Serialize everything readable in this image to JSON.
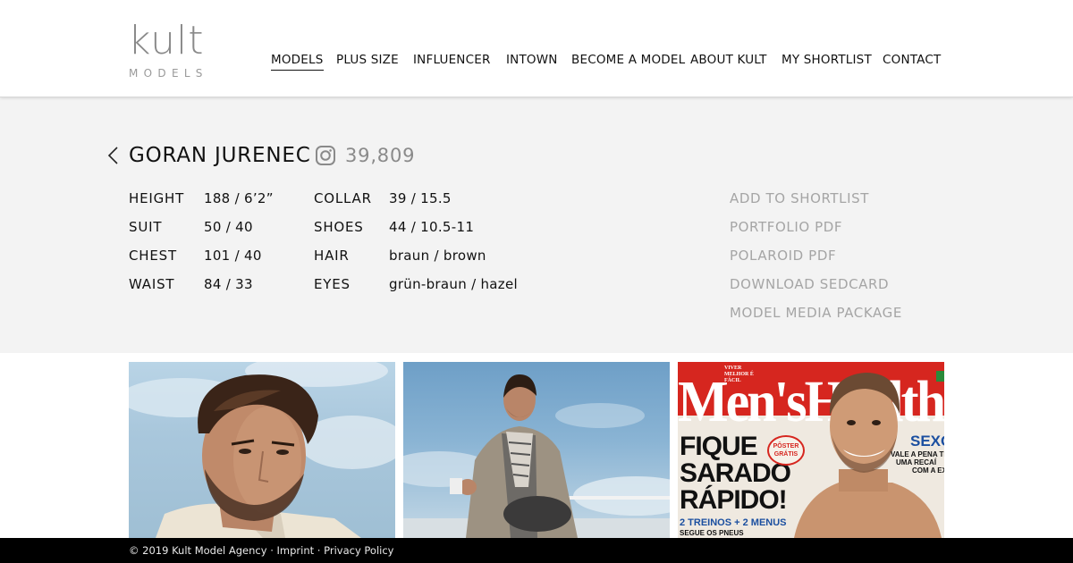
{
  "brand": {
    "logo_main": "kult",
    "logo_sub": "MODELS"
  },
  "nav": {
    "items": [
      {
        "label": "MODELS",
        "active": true
      },
      {
        "label": "PLUS SIZE"
      },
      {
        "label": "INFLUENCER"
      },
      {
        "label": "INTOWN"
      },
      {
        "label": "BECOME A MODEL"
      },
      {
        "label": "ABOUT KULT"
      },
      {
        "label": "MY SHORTLIST"
      },
      {
        "label": "CONTACT"
      }
    ]
  },
  "model": {
    "name": "GORAN JURENEC",
    "instagram_followers": "39,809",
    "stats": {
      "height": {
        "label": "HEIGHT",
        "value": "188 / 6’2”"
      },
      "suit": {
        "label": "SUIT",
        "value": "50 / 40"
      },
      "chest": {
        "label": "CHEST",
        "value": "101 / 40"
      },
      "waist": {
        "label": "WAIST",
        "value": "84 / 33"
      },
      "collar": {
        "label": "COLLAR",
        "value": "39 / 15.5"
      },
      "shoes": {
        "label": "SHOES",
        "value": "44 / 10.5-11"
      },
      "hair": {
        "label": "HAIR",
        "value": "braun / brown"
      },
      "eyes": {
        "label": "EYES",
        "value": "grün-braun / hazel"
      }
    }
  },
  "actions": {
    "add_to_shortlist": "ADD TO SHORTLIST",
    "portfolio_pdf": "PORTFOLIO PDF",
    "polaroid_pdf": "POLAROID PDF",
    "download_sedcard": "DOWNLOAD SEDCARD",
    "model_media_package": "MODEL MEDIA PACKAGE"
  },
  "magazine": {
    "title": "Men'sHealth",
    "tagline_top": "VIVER MELHOR É FÁCIL",
    "headline_1": "FIQUE",
    "headline_2": "SARADO",
    "headline_3": "RÁPIDO!",
    "sub": "2 TREINOS + 2 MENUS",
    "sub2": "SEGUE OS PNEUS",
    "badge": "PÔSTER GRÁTIS",
    "side_title": "SEXO",
    "side_text_1": "VALE A PENA TE",
    "side_text_2": "UMA RECAÍ",
    "side_text_3": "COM A EX"
  },
  "footer": {
    "copyright": "© 2019 Kult Model Agency",
    "separator": " · ",
    "imprint": "Imprint",
    "privacy": "Privacy Policy"
  },
  "colors": {
    "accent": "#111111",
    "muted": "#a5a5a5",
    "band_bg": "#f3f3f3",
    "footer_bg": "#000000",
    "magazine_red": "#d6261f"
  }
}
